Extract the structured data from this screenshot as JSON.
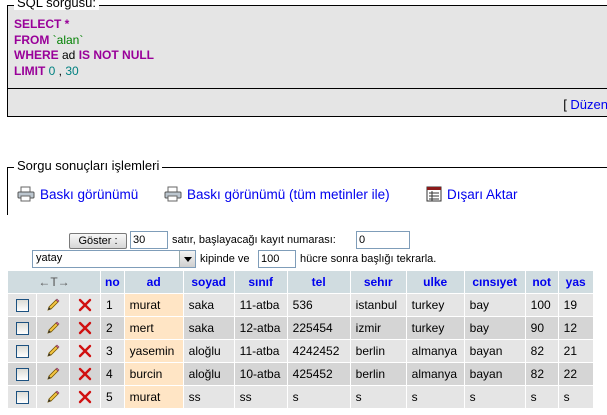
{
  "sql_panel": {
    "title": "SQL sorgusu:",
    "lines": [
      {
        "kw": "SELECT",
        "rest_num": "",
        "rest": " *"
      },
      {
        "kw": "FROM",
        "rest": " `alan`"
      },
      {
        "kw": "WHERE",
        "ident": " ad ",
        "kw2": "IS NOT NULL"
      },
      {
        "kw": "LIMIT",
        "n1": " 0",
        "sep": " , ",
        "n2": "30"
      }
    ],
    "footer_bracket": "[ ",
    "footer_link": "Düzen"
  },
  "ops": {
    "title": "Sorgu sonuçları işlemleri",
    "print_view": "Baskı görünümü",
    "print_view_full": "Baskı görünümü (tüm metinler ile)",
    "export": "Dışarı Aktar"
  },
  "nav": {
    "show_button": "Göster :",
    "rows_value": "30",
    "rows_label": "satır, başlayacağı kayıt numarası:",
    "start_value": "0",
    "mode_value": "yatay",
    "mode_label": "kipinde ve",
    "repeat_value": "100",
    "repeat_label": "hücre sonra başlığı tekrarla."
  },
  "table": {
    "arrows": "←T→",
    "columns": [
      "no",
      "ad",
      "soyad",
      "sınıf",
      "tel",
      "sehır",
      "ulke",
      "cınsıyet",
      "not",
      "yas"
    ],
    "rows": [
      [
        "1",
        "murat",
        "saka",
        "11-atba",
        "536",
        "istanbul",
        "turkey",
        "bay",
        "100",
        "19"
      ],
      [
        "2",
        "mert",
        "saka",
        "12-atba",
        "225454",
        "izmir",
        "turkey",
        "bay",
        "90",
        "12"
      ],
      [
        "3",
        "yasemin",
        "aloğlu",
        "11-atba",
        "4242452",
        "berlin",
        "almanya",
        "bayan",
        "82",
        "21"
      ],
      [
        "4",
        "burcin",
        "aloğlu",
        "10-atba",
        "425452",
        "berlin",
        "almanya",
        "bayan",
        "82",
        "22"
      ],
      [
        "5",
        "murat",
        "ss",
        "ss",
        "s",
        "s",
        "s",
        "s",
        "s",
        "s"
      ]
    ]
  },
  "colors": {
    "keyword": "#990099",
    "string": "#008000",
    "number": "#008080",
    "link": "#0000ee",
    "header_bg": "#d0dce0",
    "highlight": "#ffe5c5"
  }
}
